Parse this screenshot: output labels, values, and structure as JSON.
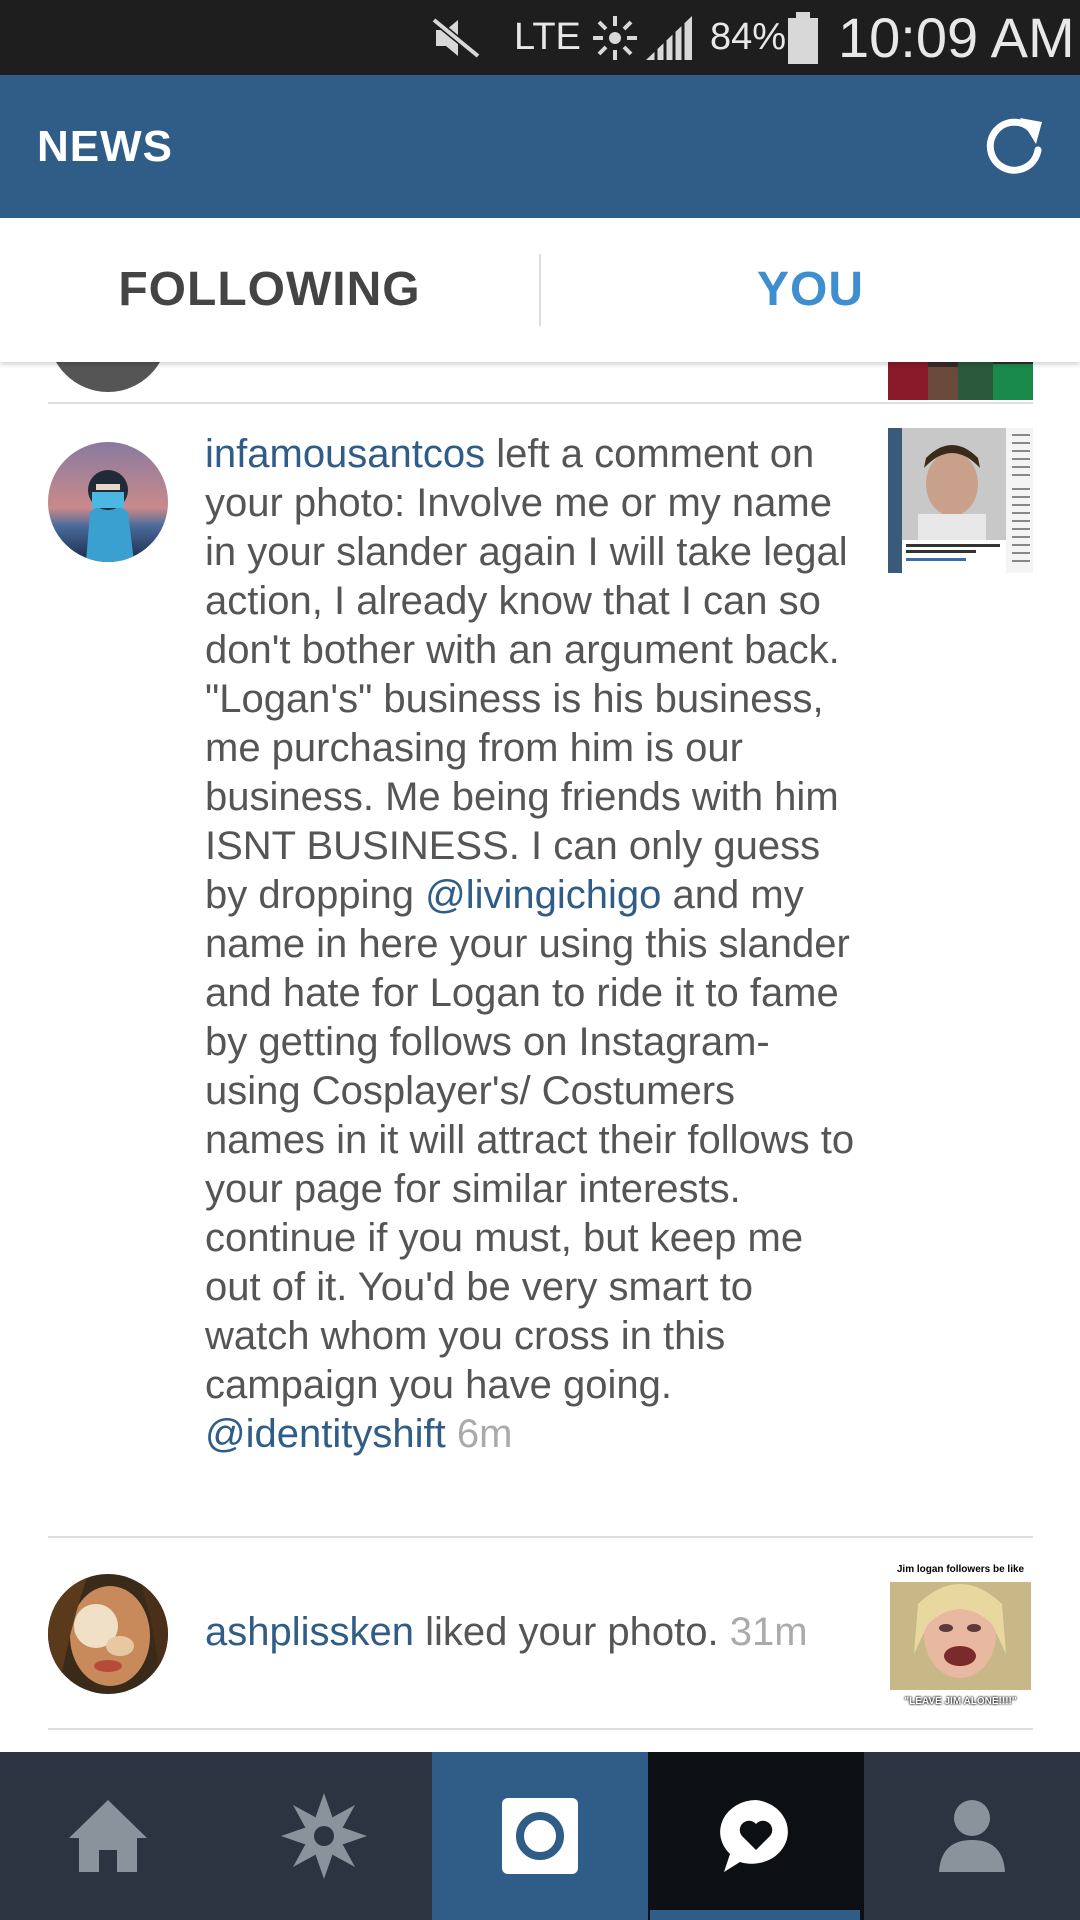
{
  "status_bar": {
    "network": "LTE",
    "battery": "84%",
    "time": "10:09 AM"
  },
  "app_bar": {
    "title": "NEWS",
    "refresh_icon": "refresh-icon"
  },
  "tabs": [
    {
      "label": "FOLLOWING",
      "active": false
    },
    {
      "label": "YOU",
      "active": true
    }
  ],
  "feed": {
    "items": [
      {
        "username": "infamousantcos",
        "action": " left a comment on your photo: Involve me or my name in your slander again I will take legal action, I already know that I can so don't bother with an argument back. \"Logan's\" business is his business, me purchasing from him is our business. Me being friends with him ISNT BUSINESS. I can only guess by dropping ",
        "mention1": "@livingichigo",
        "action2": " and my name in here your using this slander and hate for Logan to ride it to fame by getting follows on Instagram- using Cosplayer's/ Costumers names in it will attract their follows to your page for similar interests. continue if you must, but keep me out of it. You'd be very smart to watch whom you cross in this campaign you have going. ",
        "mention2": "@identityshift",
        "time": "6m",
        "thumb_caption": "COSPLAY WARNING: Don't order from Jim Logan Props!"
      },
      {
        "username": "ashplissken",
        "action": " liked your photo. ",
        "time": "31m",
        "thumb_top": "Jim logan followers be like",
        "thumb_bottom": "\"LEAVE JIM ALONE!!!!\""
      }
    ]
  },
  "bottom_nav": [
    {
      "name": "home-icon"
    },
    {
      "name": "explore-icon"
    },
    {
      "name": "camera-icon"
    },
    {
      "name": "news-icon",
      "active": true
    },
    {
      "name": "profile-icon"
    }
  ],
  "colors": {
    "brand": "#2f5d87",
    "tab_active": "#3f8fd0",
    "link": "#2f5d87"
  }
}
